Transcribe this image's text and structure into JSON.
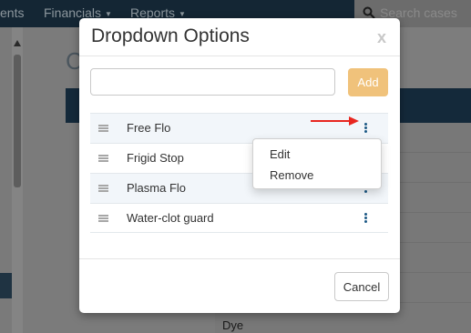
{
  "app": {
    "nav": [
      {
        "label": "ents"
      },
      {
        "label": "Financials"
      },
      {
        "label": "Reports"
      }
    ],
    "search_placeholder": "Search cases",
    "page_letter": "C",
    "table_cell": "Dye"
  },
  "modal": {
    "title": "Dropdown Options",
    "close_glyph": "x",
    "input_value": "",
    "input_placeholder": "",
    "add_label": "Add",
    "options": [
      {
        "label": "Free Flo"
      },
      {
        "label": "Frigid Stop"
      },
      {
        "label": "Plasma Flo"
      },
      {
        "label": "Water-clot guard"
      }
    ],
    "context_menu": {
      "items": [
        {
          "label": "Edit"
        },
        {
          "label": "Remove"
        }
      ]
    },
    "cancel_label": "Cancel"
  },
  "colors": {
    "add_button": "#f0c27b",
    "kebab": "#1d5a86",
    "arrow": "#e8261f",
    "nav_bar": "#142634"
  },
  "icons": [
    "search-icon",
    "drag-handle-icon",
    "more-vertical-icon",
    "close-icon",
    "chevron-down-icon"
  ]
}
